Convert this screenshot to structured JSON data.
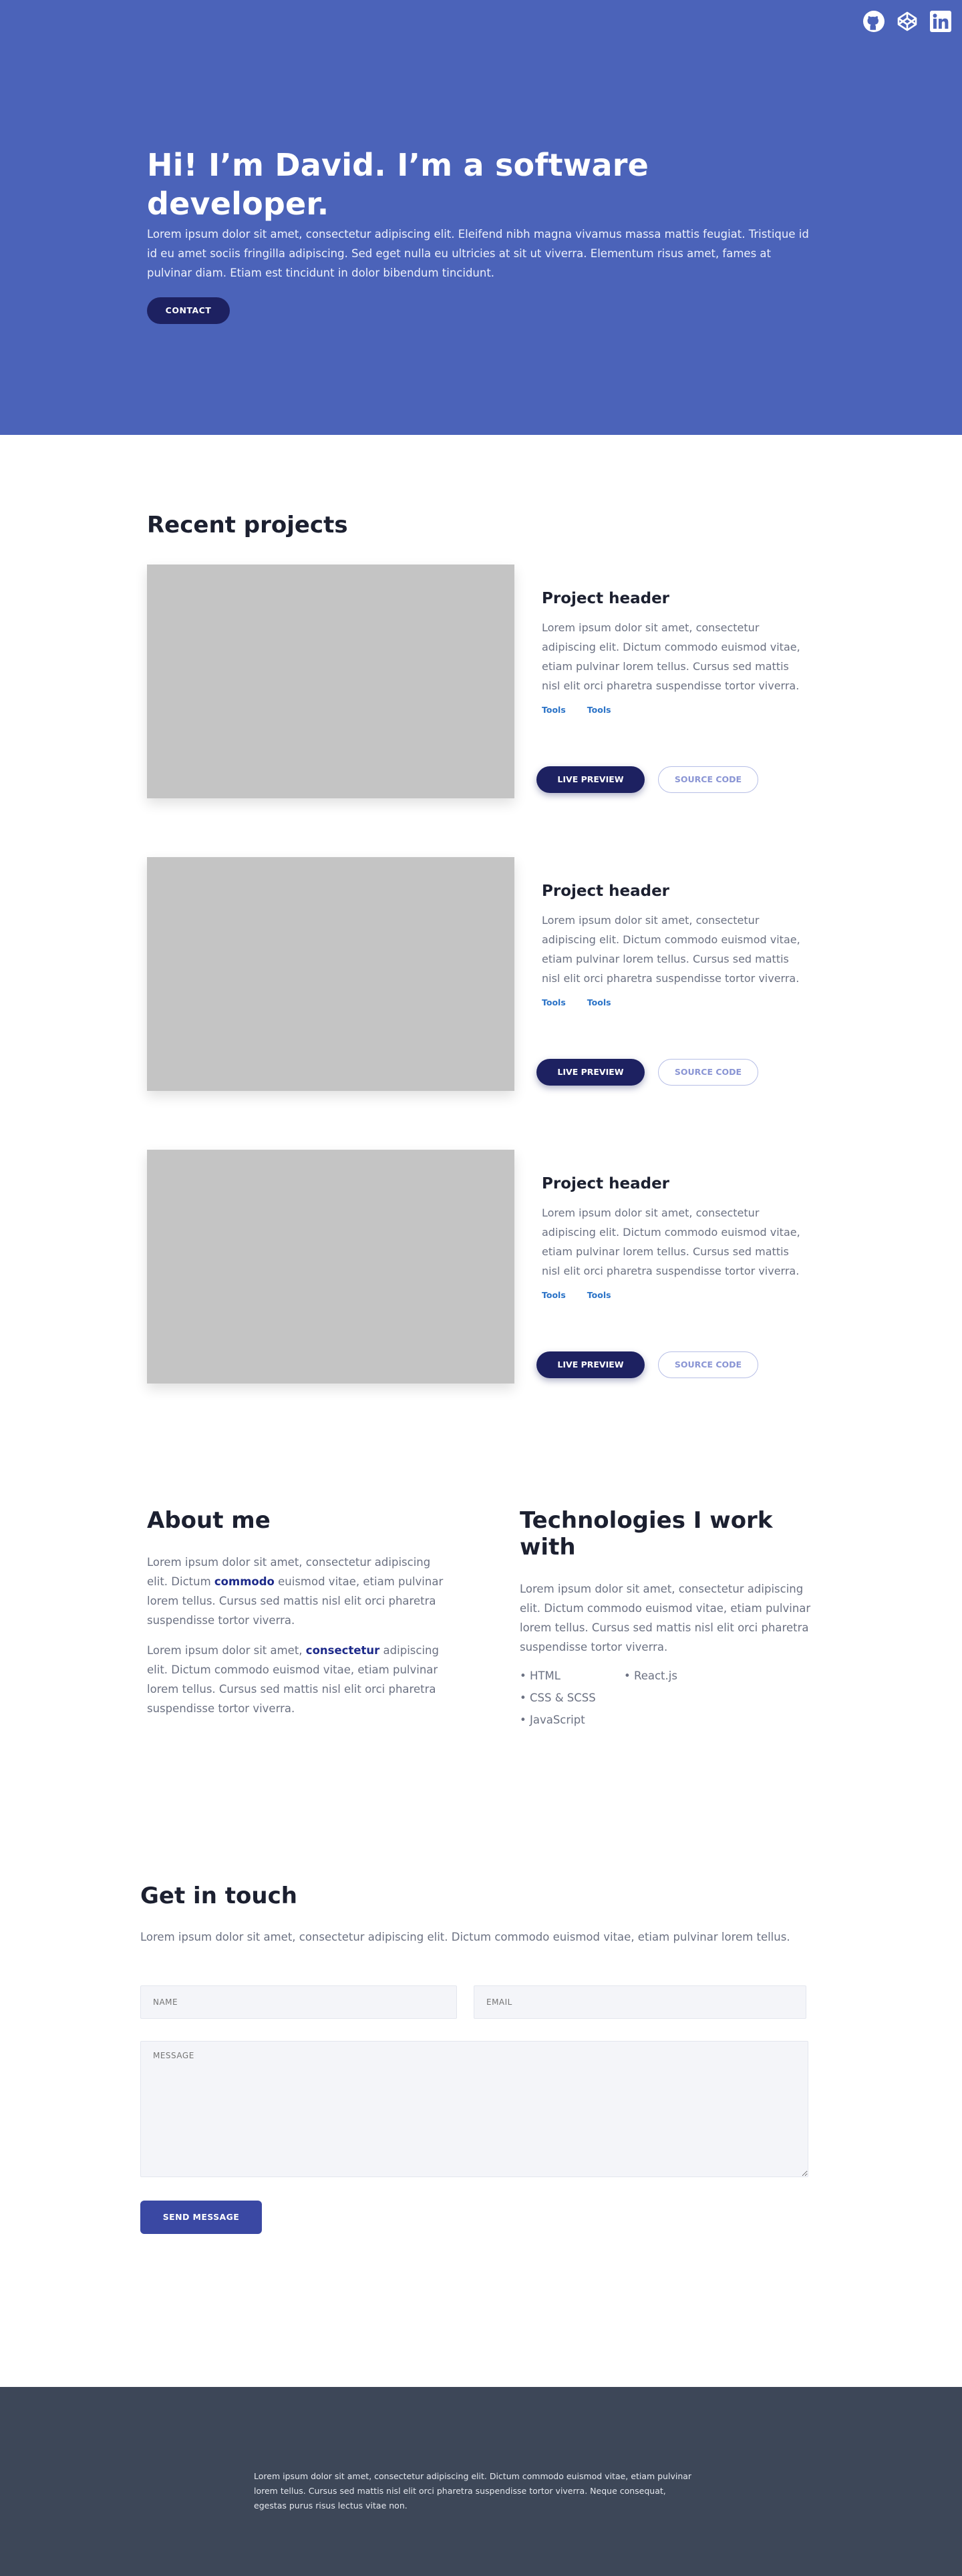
{
  "social": {
    "github_icon": "github-icon",
    "codepen_icon": "codepen-icon",
    "linkedin_icon": "linkedin-icon"
  },
  "hero": {
    "title": "Hi! I’m David. I’m a software developer.",
    "text": "Lorem ipsum dolor sit amet, consectetur adipiscing elit. Eleifend nibh magna vivamus massa mattis feugiat. Tristique id id eu amet sociis fringilla adipiscing. Sed eget nulla eu ultricies at sit ut viverra. Elementum risus amet, fames at pulvinar diam. Etiam est tincidunt in dolor bibendum tincidunt.",
    "contact_label": "CONTACT"
  },
  "projects": {
    "title": "Recent projects",
    "items": [
      {
        "header": "Project header",
        "text": "Lorem ipsum dolor sit amet, consectetur adipiscing elit. Dictum commodo euismod vitae, etiam pulvinar lorem tellus. Cursus sed mattis nisl elit orci pharetra suspendisse tortor viverra.",
        "tools": [
          "Tools",
          "Tools"
        ],
        "live_label": "LIVE PREVIEW",
        "source_label": "SOURCE CODE"
      },
      {
        "header": "Project header",
        "text": "Lorem ipsum dolor sit amet, consectetur adipiscing elit. Dictum commodo euismod vitae, etiam pulvinar lorem tellus. Cursus sed mattis nisl elit orci pharetra suspendisse tortor viverra.",
        "tools": [
          "Tools",
          "Tools"
        ],
        "live_label": "LIVE PREVIEW",
        "source_label": "SOURCE CODE"
      },
      {
        "header": "Project header",
        "text": "Lorem ipsum dolor sit amet, consectetur adipiscing elit. Dictum commodo euismod vitae, etiam pulvinar lorem tellus. Cursus sed mattis nisl elit orci pharetra suspendisse tortor viverra.",
        "tools": [
          "Tools",
          "Tools"
        ],
        "live_label": "LIVE PREVIEW",
        "source_label": "SOURCE CODE"
      }
    ]
  },
  "about": {
    "title": "About me",
    "p1_before": "Lorem ipsum dolor sit amet, consectetur adipiscing elit. Dictum ",
    "p1_bold": "commodo",
    "p1_after": " euismod vitae, etiam pulvinar lorem tellus. Cursus sed mattis nisl elit orci pharetra suspendisse tortor viverra.",
    "p2_before": "Lorem ipsum dolor sit amet, ",
    "p2_bold": "consectetur",
    "p2_after": " adipiscing elit. Dictum commodo euismod vitae, etiam pulvinar lorem tellus. Cursus sed mattis nisl elit orci pharetra suspendisse tortor viverra."
  },
  "tech": {
    "title": "Technologies I work with",
    "text": "Lorem ipsum dolor sit amet, consectetur adipiscing elit. Dictum commodo euismod vitae, etiam pulvinar lorem tellus. Cursus sed mattis nisl elit orci pharetra suspendisse tortor viverra.",
    "items": [
      "• HTML",
      "• React.js",
      "• CSS & SCSS",
      "",
      "• JavaScript",
      ""
    ]
  },
  "contact": {
    "title": "Get in touch",
    "lead": "Lorem ipsum dolor sit amet, consectetur adipiscing elit. Dictum commodo euismod vitae, etiam pulvinar lorem tellus.",
    "name_placeholder": "NAME",
    "email_placeholder": "EMAIL",
    "message_placeholder": "MESSAGE",
    "send_label": "SEND MESSAGE"
  },
  "footer": {
    "text": "Lorem ipsum dolor sit amet, consectetur adipiscing elit. Dictum commodo euismod vitae, etiam pulvinar lorem tellus. Cursus sed mattis nisl elit orci pharetra suspendisse tortor viverra. Neque consequat, egestas purus risus lectus vitae non."
  },
  "colors": {
    "hero_bg": "#4b63b9",
    "primary_button": "#1d2161",
    "send_button": "#3a48a3",
    "footer_bg": "#3d4758",
    "image_placeholder": "#c4c4c4"
  }
}
